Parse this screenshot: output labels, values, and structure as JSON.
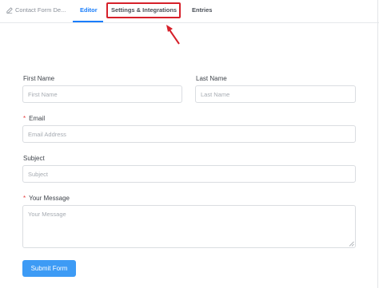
{
  "header": {
    "form_title": "Contact Form De...",
    "tabs": [
      {
        "label": "Editor",
        "active": true
      },
      {
        "label": "Settings & Integrations",
        "active": false
      },
      {
        "label": "Entries",
        "active": false
      }
    ],
    "accent_color": "#1a7efb",
    "annotation_color": "#d6202a"
  },
  "form": {
    "first_name": {
      "label": "First Name",
      "placeholder": "First Name"
    },
    "last_name": {
      "label": "Last Name",
      "placeholder": "Last Name"
    },
    "email": {
      "label": "Email",
      "placeholder": "Email Address",
      "required": true
    },
    "subject": {
      "label": "Subject",
      "placeholder": "Subject"
    },
    "message": {
      "label": "Your Message",
      "placeholder": "Your Message",
      "required": true
    },
    "required_marker": "*",
    "submit_label": "Submit Form",
    "submit_color": "#3d9bf5"
  }
}
